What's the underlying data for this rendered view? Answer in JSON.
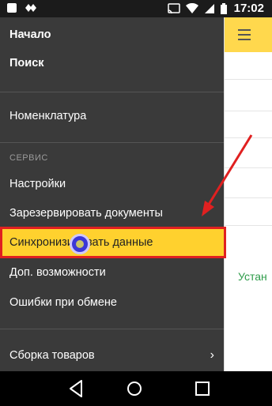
{
  "status_bar": {
    "time": "17:02",
    "left_icons": [
      "notification-icon",
      "diamond-icon"
    ],
    "right_icons": [
      "cast-icon",
      "wifi-icon",
      "signal-icon",
      "battery-icon"
    ]
  },
  "drawer": {
    "items_top": [
      {
        "label": "Начало"
      },
      {
        "label": "Поиск"
      }
    ],
    "nomenclature": {
      "label": "Номенклатура"
    },
    "service_section": "СЕРВИС",
    "service_items": [
      {
        "label": "Настройки"
      },
      {
        "label": "Зарезервировать документы"
      },
      {
        "label": "Синхронизировать данные"
      },
      {
        "label": "Доп. возможности"
      },
      {
        "label": "Ошибки при обмене"
      }
    ],
    "bottom_item": {
      "label": "Сборка товаров"
    }
  },
  "right_pane": {
    "partial_text": "Устан"
  },
  "colors": {
    "drawer_bg": "#3a3a3a",
    "highlight": "#ffd12e",
    "annotation": "#e02020",
    "header_yellow": "#ffd84d",
    "green_text": "#2e9c4a"
  },
  "navigation": [
    "back-icon",
    "home-icon",
    "recents-icon"
  ]
}
